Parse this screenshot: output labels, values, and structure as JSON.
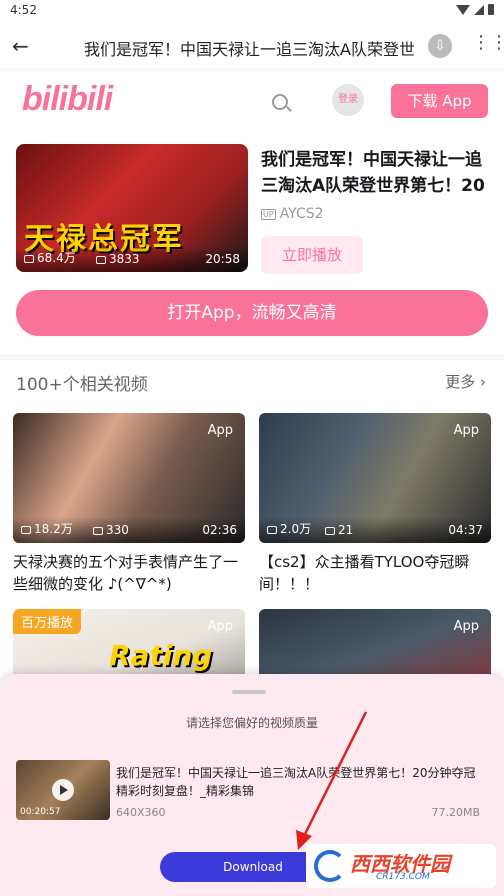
{
  "status_bar": {
    "time": "4:52"
  },
  "top_bar": {
    "title": "我们是冠军！中国天禄让一追三淘汰A队荣登世界第七！20分钟夺冠精彩时刻复盘！_精彩集锦"
  },
  "header": {
    "logo": "bilibili",
    "login_label": "登录",
    "download_app_label": "下载 App"
  },
  "main_video": {
    "thumb_text": "天禄总冠军",
    "views": "68.4万",
    "danmaku": "3833",
    "duration": "20:58",
    "title": "我们是冠军！中国天禄让一追三淘汰A队荣登世界第七！20分钟夺冠精彩时刻复盘！_精彩集锦",
    "uploader": "AYCS2",
    "up_badge": "UP",
    "play_label": "立即播放"
  },
  "open_app_label": "打开App，流畅又高清",
  "related": {
    "heading": "100+个相关视频",
    "more_label": "更多",
    "items": [
      {
        "title": "天禄决赛的五个对手表情产生了一些细微的变化 ♪(^∇^*)",
        "views": "18.2万",
        "danmaku": "330",
        "duration": "02:36",
        "tag": "App",
        "badge": ""
      },
      {
        "title": "【cs2】众主播看TYLOO夺冠瞬间！！！",
        "views": "2.0万",
        "danmaku": "21",
        "duration": "04:37",
        "tag": "App",
        "badge": ""
      },
      {
        "title": "",
        "views": "",
        "danmaku": "",
        "duration": "",
        "tag": "App",
        "badge": "百万播放",
        "thumb_text": "Rating"
      },
      {
        "title": "",
        "views": "",
        "danmaku": "",
        "duration": "",
        "tag": "App",
        "badge": ""
      }
    ]
  },
  "quality_sheet": {
    "prompt": "请选择您偏好的视频质量",
    "video_title": "我们是冠军！中国天禄让一追三淘汰A队荣登世界第七！20分钟夺冠精彩时刻复盘！_精彩集锦",
    "thumb_duration": "00:20:57",
    "resolution": "640X360",
    "file_size": "77.20MB",
    "download_label": "Download"
  },
  "watermark": {
    "text": "西西软件园",
    "sub": "CR173.COM"
  },
  "colors": {
    "brand_pink": "#fb7299",
    "download_blue": "#3b3bd9",
    "arrow_red": "#e0201b"
  }
}
